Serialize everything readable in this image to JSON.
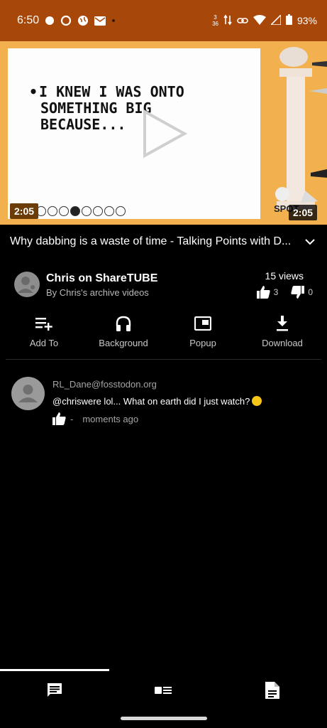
{
  "status_bar": {
    "time": "6:50",
    "net_top": "3",
    "net_bottom": "36",
    "battery": "93%"
  },
  "player": {
    "slide_lines": [
      "I KNEW I WAS ONTO",
      "SOMETHING BIG",
      "BECAUSE..."
    ],
    "duration_left": "2:05",
    "duration_right": "2:05",
    "corner_text": "SPOT"
  },
  "video": {
    "title": "Why dabbing is a waste of time - Talking Points with D..."
  },
  "channel": {
    "name": "Chris on ShareTUBE",
    "subtitle": "By Chris's archive videos",
    "views": "15 views",
    "likes": "3",
    "dislikes": "0"
  },
  "actions": {
    "add_to": "Add To",
    "background": "Background",
    "popup": "Popup",
    "download": "Download"
  },
  "comment": {
    "author": "RL_Dane@fosstodon.org",
    "text": "@chriswere lol... What on earth did I just watch?",
    "like_count": "-",
    "time": "moments ago"
  },
  "colors": {
    "status_bar": "#a8470a",
    "player_bg": "#f2b14e",
    "background": "#000000"
  }
}
